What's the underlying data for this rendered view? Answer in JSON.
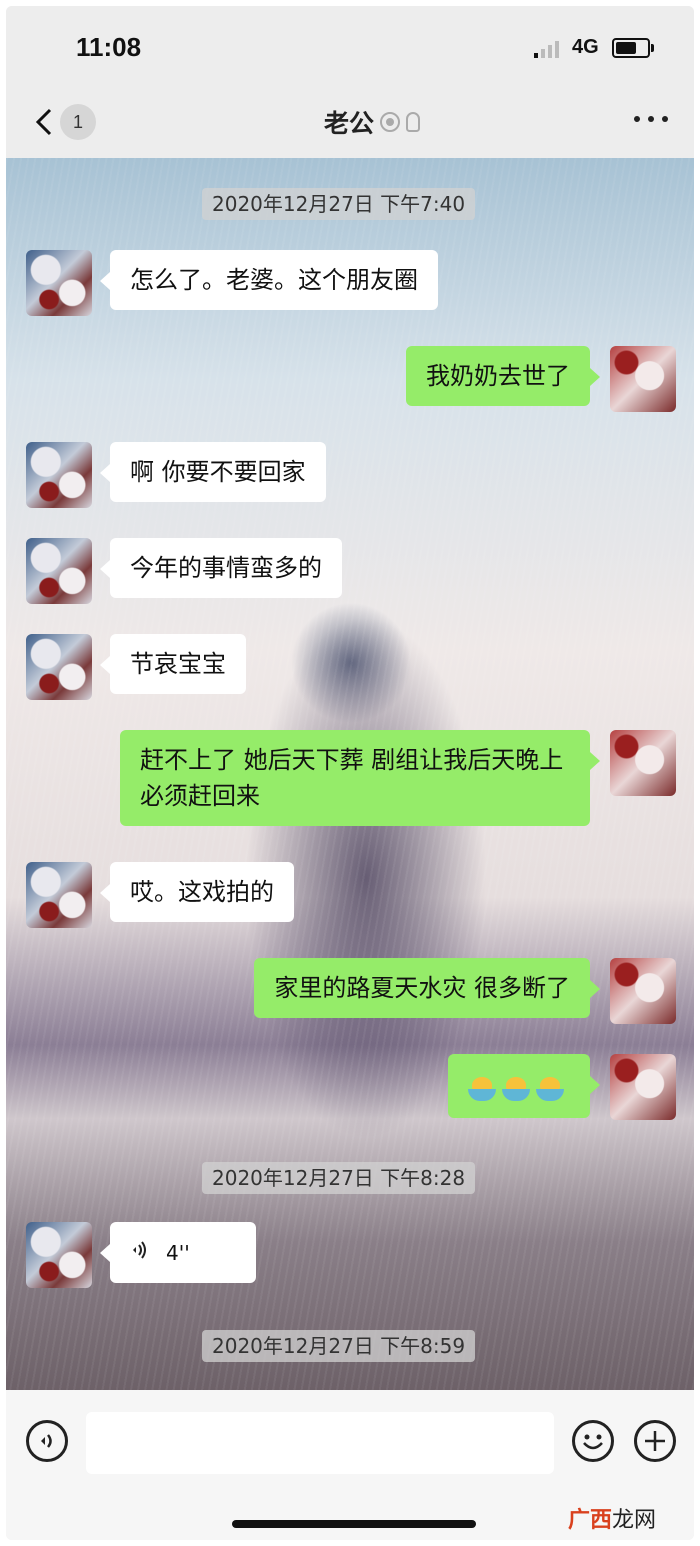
{
  "status_bar": {
    "time": "11:08",
    "network": "4G"
  },
  "nav": {
    "back_badge": "1",
    "title": "老公"
  },
  "messages": [
    {
      "side": "timestamp",
      "text": "2020年12月27日 下午7:40"
    },
    {
      "side": "left",
      "text": "怎么了。老婆。这个朋友圈"
    },
    {
      "side": "right",
      "text": "我奶奶去世了"
    },
    {
      "side": "left",
      "text": "啊 你要不要回家"
    },
    {
      "side": "left",
      "text": "今年的事情蛮多的"
    },
    {
      "side": "left",
      "text": "节哀宝宝"
    },
    {
      "side": "right",
      "text": "赶不上了 她后天下葬 剧组让我后天晚上必须赶回来"
    },
    {
      "side": "left",
      "text": "哎。这戏拍的"
    },
    {
      "side": "right",
      "text": "家里的路夏天水灾 很多断了"
    },
    {
      "side": "right",
      "text": "emoji x3",
      "emoji": [
        "duck-emoji",
        "duck-emoji",
        "duck-emoji"
      ]
    },
    {
      "side": "timestamp",
      "text": "2020年12月27日 下午8:28"
    },
    {
      "side": "left",
      "type": "voice",
      "text": "4''"
    },
    {
      "side": "timestamp",
      "text": "2020年12月27日 下午8:59"
    }
  ],
  "input_bar": {
    "icons": [
      "voice-icon",
      "emoji-icon",
      "plus-icon"
    ]
  },
  "watermark": {
    "text_colored": "广西",
    "text_dark": "龙网"
  },
  "colors": {
    "right_bubble": "#95ec69",
    "left_bubble": "#ffffff",
    "bar_bg": "#ededed"
  }
}
